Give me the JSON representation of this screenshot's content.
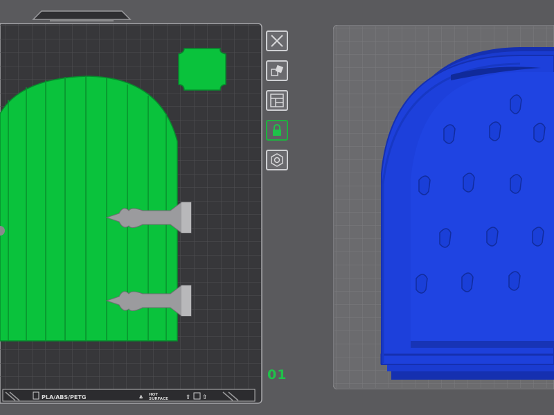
{
  "left_plate": {
    "material_label": "PLA/ABS/PETG",
    "hot_label_line1": "HOT",
    "hot_label_line2": "SURFACE",
    "plate_number": "01",
    "model_color": "#0ac23c",
    "model_name": "arched door (green)",
    "hardware_name": "door hinge pieces (gray)",
    "small_part_name": "square tile (green)"
  },
  "toolbar": {
    "items": [
      {
        "name": "close",
        "icon": "close-icon",
        "state": "inactive"
      },
      {
        "name": "arrange",
        "icon": "arrange-icon",
        "state": "inactive"
      },
      {
        "name": "layout",
        "icon": "layout-icon",
        "state": "inactive"
      },
      {
        "name": "lock",
        "icon": "lock-icon",
        "state": "active"
      },
      {
        "name": "settings",
        "icon": "settings-icon",
        "state": "inactive"
      }
    ]
  },
  "right_plate": {
    "model_color": "#1a3fdc",
    "model_name": "arched door back (blue)"
  },
  "colors": {
    "background": "#5a5a5d",
    "bed_dark": "#3a3a3d",
    "bed_light": "#6b6b6e",
    "accent_green": "#1fc24a"
  }
}
